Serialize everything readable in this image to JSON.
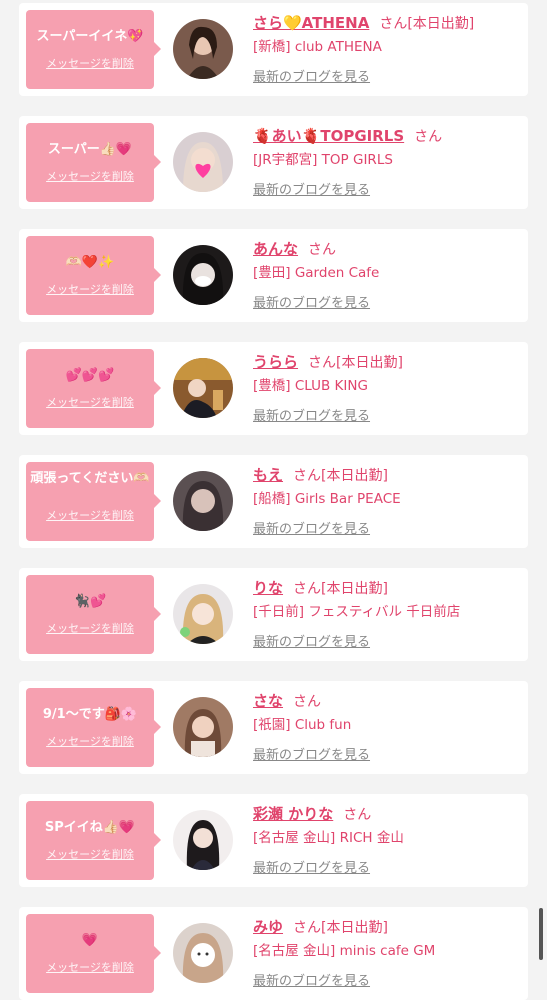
{
  "delete_label": "メッセージを削除",
  "blog_label": "最新のブログを見る",
  "san_label": "さん",
  "today_label": "[本日出勤]",
  "colors": {
    "accent": "#e0446c",
    "bubble": "#f6a0b0",
    "background": "#f3f3f3"
  },
  "cards": [
    {
      "message": "スーパーイイネ💖",
      "name": "さら💛ATHENA",
      "shop": "[新橋] club ATHENA",
      "working_today": true
    },
    {
      "message": "スーパー👍🏻💗",
      "name": "🫀あい🫀TOPGIRLS",
      "shop": "[JR宇都宮] TOP GIRLS",
      "working_today": false
    },
    {
      "message": "🫶🏻❤️✨",
      "name": "あんな",
      "shop": "[豊田] Garden Cafe",
      "working_today": false
    },
    {
      "message": "💕💕💕",
      "name": "うらら",
      "shop": "[豊橋] CLUB KING",
      "working_today": true
    },
    {
      "message": "頑張ってください🫶🏻",
      "name": "もえ",
      "shop": "[船橋] Girls Bar PEACE",
      "working_today": true
    },
    {
      "message": "🐈‍⬛💕",
      "name": "りな",
      "shop": "[千日前] フェスティバル 千日前店",
      "working_today": true
    },
    {
      "message": "9/1〜です🎒🌸",
      "name": "さな",
      "shop": "[祇園] Club fun",
      "working_today": false
    },
    {
      "message": "SPイイね👍🏻💗",
      "name": "彩瀬 かりな",
      "shop": "[名古屋 金山] RICH 金山",
      "working_today": false
    },
    {
      "message": "💗",
      "name": "みゆ",
      "shop": "[名古屋 金山] minis cafe GM",
      "working_today": true
    }
  ]
}
